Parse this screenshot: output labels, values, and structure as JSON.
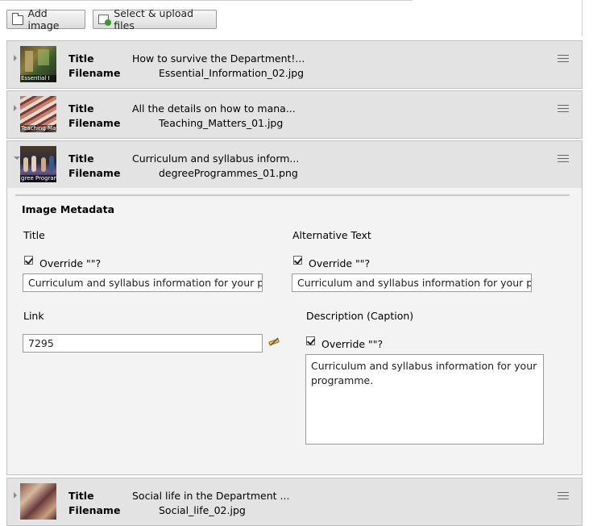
{
  "toolbar": {
    "add_image_label": "Add image",
    "add_image_icon": "folder-icon",
    "upload_label": "Select & upload files",
    "upload_icon": "upload-icon"
  },
  "labels": {
    "title": "Title",
    "filename": "Filename"
  },
  "images": [
    {
      "title": "How to survive the Department!...",
      "filename": "Essential_Information_02.jpg",
      "thumb_text": "Essential I",
      "expanded": false
    },
    {
      "title": "All the details on how to mana...",
      "filename": "Teaching_Matters_01.jpg",
      "thumb_text": "Teaching Matte",
      "expanded": false
    },
    {
      "title": "Curriculum and syllabus inform...",
      "filename": "degreeProgrammes_01.png",
      "thumb_text": "gree Programm",
      "expanded": true
    },
    {
      "title": "Social life in the Department ...",
      "filename": "Social_life_02.jpg",
      "thumb_text": "",
      "expanded": false
    }
  ],
  "metadata": {
    "heading": "Image Metadata",
    "title_label": "Title",
    "title_override_label": "Override \"\"?",
    "title_override_checked": true,
    "title_value": "Curriculum and syllabus information for your programme",
    "alt_label": "Alternative Text",
    "alt_override_label": "Override \"\"?",
    "alt_override_checked": true,
    "alt_value": "Curriculum and syllabus information for your programme",
    "link_label": "Link",
    "link_value": "7295",
    "link_wizard_icon": "link-wizard-icon",
    "desc_label": "Description (Caption)",
    "desc_override_label": "Override \"\"?",
    "desc_override_checked": true,
    "desc_value": "Curriculum and syllabus information for your programme."
  }
}
